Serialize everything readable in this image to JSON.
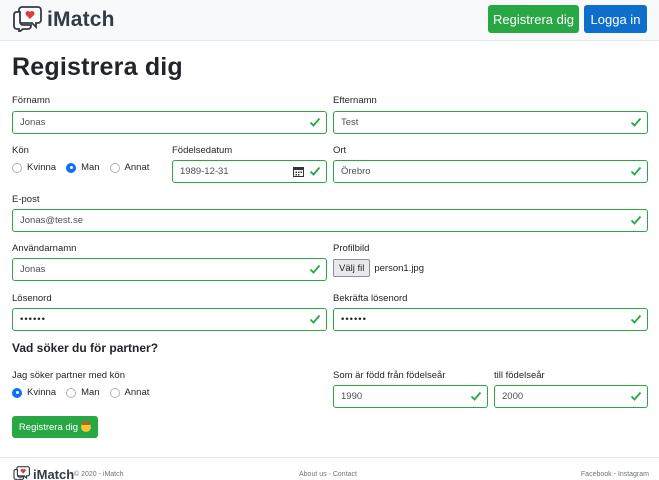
{
  "navbar": {
    "brand": "iMatch",
    "register_label": "Registrera dig",
    "login_label": "Logga in"
  },
  "page": {
    "title": "Registrera dig"
  },
  "form": {
    "first_name": {
      "label": "Förnamn",
      "value": "Jonas"
    },
    "last_name": {
      "label": "Efternamn",
      "value": "Test"
    },
    "gender": {
      "label": "Kön",
      "options": [
        "Kvinna",
        "Man",
        "Annat"
      ],
      "selected": "Man"
    },
    "birthdate": {
      "label": "Födelsedatum",
      "value": "1989-12-31"
    },
    "city": {
      "label": "Ort",
      "value": "Örebro"
    },
    "email": {
      "label": "E-post",
      "value": "Jonas@test.se"
    },
    "username": {
      "label": "Användarnamn",
      "value": "Jonas"
    },
    "profile_image": {
      "label": "Profilbild",
      "button_label": "Välj fil",
      "file_name": "person1.jpg"
    },
    "password": {
      "label": "Lösenord",
      "value": "••••••"
    },
    "confirm_password": {
      "label": "Bekräfta lösenord",
      "value": "••••••"
    },
    "partner_section_title": "Vad söker du för partner?",
    "partner_gender": {
      "label": "Jag söker partner med kön",
      "options": [
        "Kvinna",
        "Man",
        "Annat"
      ],
      "selected": "Kvinna"
    },
    "birth_year_from": {
      "label": "Som är född från födelseår",
      "value": "1990"
    },
    "birth_year_to": {
      "label": "till födelseår",
      "value": "2000"
    },
    "submit_label": "Registrera dig"
  },
  "footer": {
    "brand": "iMatch",
    "copyright": "© 2020 - iMatch",
    "middle_links": "About us - Contact",
    "right_links": "Facebook - Instagram"
  },
  "colors": {
    "success": "#28a745",
    "primary": "#0d6ecc",
    "valid_border": "#28a745"
  },
  "icons": [
    "logo-chat-heart-icon",
    "check-icon",
    "calendar-icon",
    "smile-emoji-icon"
  ]
}
